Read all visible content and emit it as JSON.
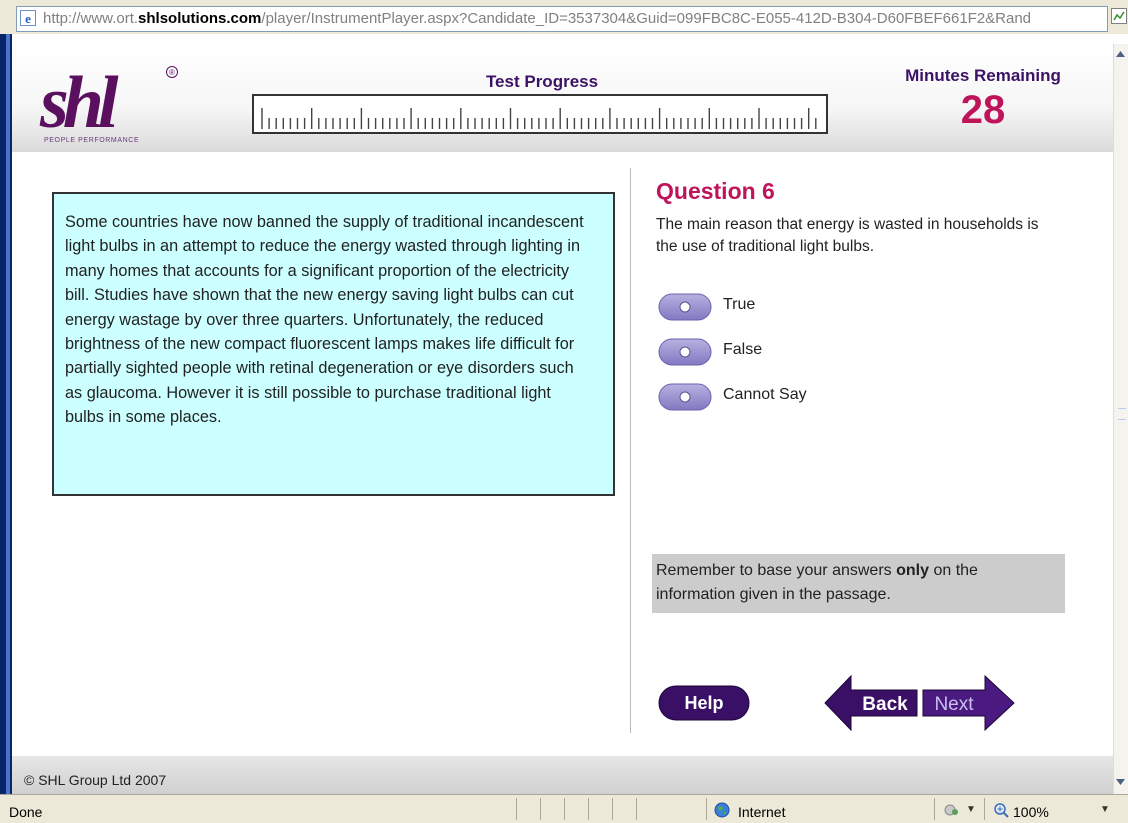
{
  "browser": {
    "address_prefix": "http://www.ort.",
    "address_domain": "shlsolutions.com",
    "address_suffix": "/player/InstrumentPlayer.aspx?Candidate_ID=3537304&Guid=099FBC8C-E055-412D-B304-D60FBEF661F2&Rand"
  },
  "header": {
    "logo_text": "shl",
    "logo_registered": "®",
    "logo_tagline": "PEOPLE PERFORMANCE",
    "progress_title": "Test Progress",
    "progress_fraction": 0.0,
    "minutes_title": "Minutes Remaining",
    "minutes_value": "28"
  },
  "passage": {
    "text": "Some countries have now banned the supply of traditional incandescent light bulbs in an attempt to reduce the energy wasted through lighting in many homes that accounts for a significant proportion of the electricity bill. Studies have shown that the new energy saving light bulbs can cut energy wastage by over three quarters.  Unfortunately, the reduced brightness of the new compact fluorescent lamps makes life difficult for partially sighted people with retinal degeneration or eye disorders such as glaucoma.  However it is still possible to purchase traditional light bulbs in some places."
  },
  "question": {
    "title": "Question 6",
    "text": "The main reason that energy is wasted in households is the use of traditional light bulbs.",
    "options": [
      {
        "label": "True"
      },
      {
        "label": "False"
      },
      {
        "label": "Cannot Say"
      }
    ],
    "reminder_before": "Remember to base your answers ",
    "reminder_bold": "only",
    "reminder_after": " on the information given in the passage."
  },
  "navigation": {
    "help_label": "Help",
    "back_label": "Back",
    "next_label": "Next"
  },
  "footer": {
    "copyright": "© SHL Group Ltd 2007"
  },
  "statusbar": {
    "status": "Done",
    "zone": "Internet",
    "zoom": "100%"
  },
  "colors": {
    "brand_purple": "#3b1265",
    "accent_magenta": "#c0145a",
    "passage_bg": "#ccffff"
  }
}
